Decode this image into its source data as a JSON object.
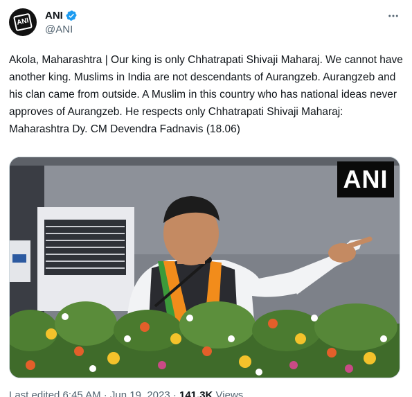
{
  "author": {
    "name": "ANI",
    "handle": "@ANI",
    "avatar_logo_text": "ANI"
  },
  "tweet": {
    "text": "Akola, Maharashtra | Our king is only Chhatrapati Shivaji Maharaj. We cannot have another king. Muslims in India are not descendants of Aurangzeb. Aurangzeb and his clan came from outside. A Muslim in this country who has national ideas never approves of Aurangzeb. He respects only Chhatrapati Shivaji Maharaj: Maharashtra Dy. CM Devendra Fadnavis (18.06)"
  },
  "media": {
    "watermark": "ANI"
  },
  "footer": {
    "edited": "Last edited 6:45 AM · Jun 19, 2023 ·",
    "views_count": "141.3K",
    "views_label": "Views"
  },
  "icons": {
    "verified": "verified-badge-icon",
    "more": "more-dots-icon"
  },
  "colors": {
    "verified": "#1d9bf0",
    "secondary_text": "#536471",
    "primary_text": "#0f1419"
  }
}
